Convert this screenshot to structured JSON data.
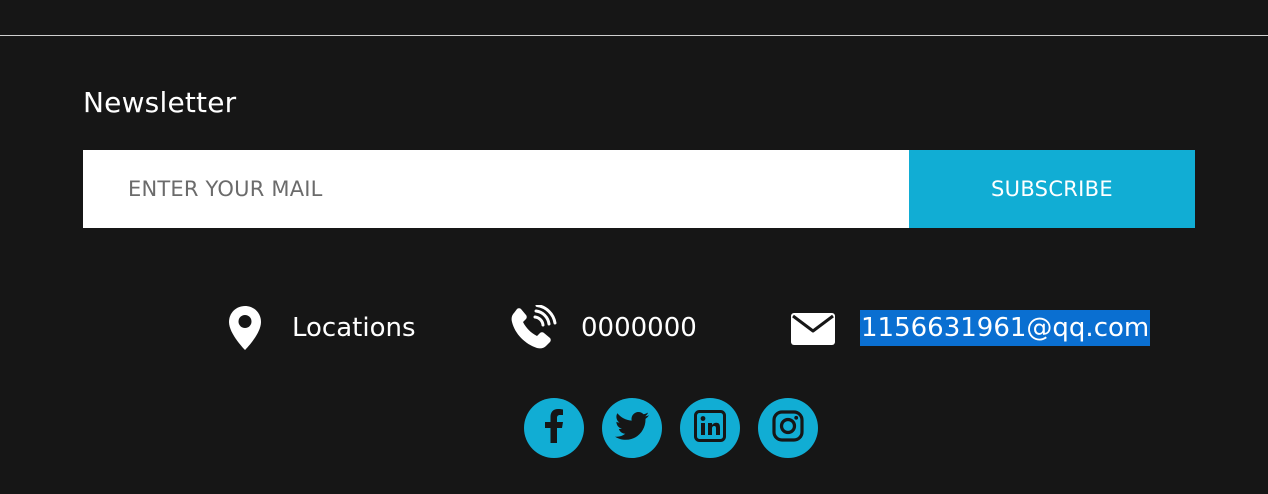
{
  "newsletter": {
    "title": "Newsletter",
    "email_placeholder": "ENTER YOUR MAIL",
    "email_value": "",
    "subscribe_label": "SUBSCRIBE"
  },
  "contact": {
    "location": {
      "icon": "map-pin-icon",
      "text": "Locations"
    },
    "phone": {
      "icon": "phone-icon",
      "text": "0000000"
    },
    "email": {
      "icon": "envelope-icon",
      "text": "1156631961@qq.com",
      "selected": true
    }
  },
  "social": [
    {
      "name": "facebook",
      "icon": "facebook-icon"
    },
    {
      "name": "twitter",
      "icon": "twitter-icon"
    },
    {
      "name": "linkedin",
      "icon": "linkedin-icon"
    },
    {
      "name": "instagram",
      "icon": "instagram-icon"
    }
  ],
  "colors": {
    "background": "#161616",
    "accent": "#11add4",
    "text": "#ffffff",
    "selection": "#0a6fd1"
  }
}
